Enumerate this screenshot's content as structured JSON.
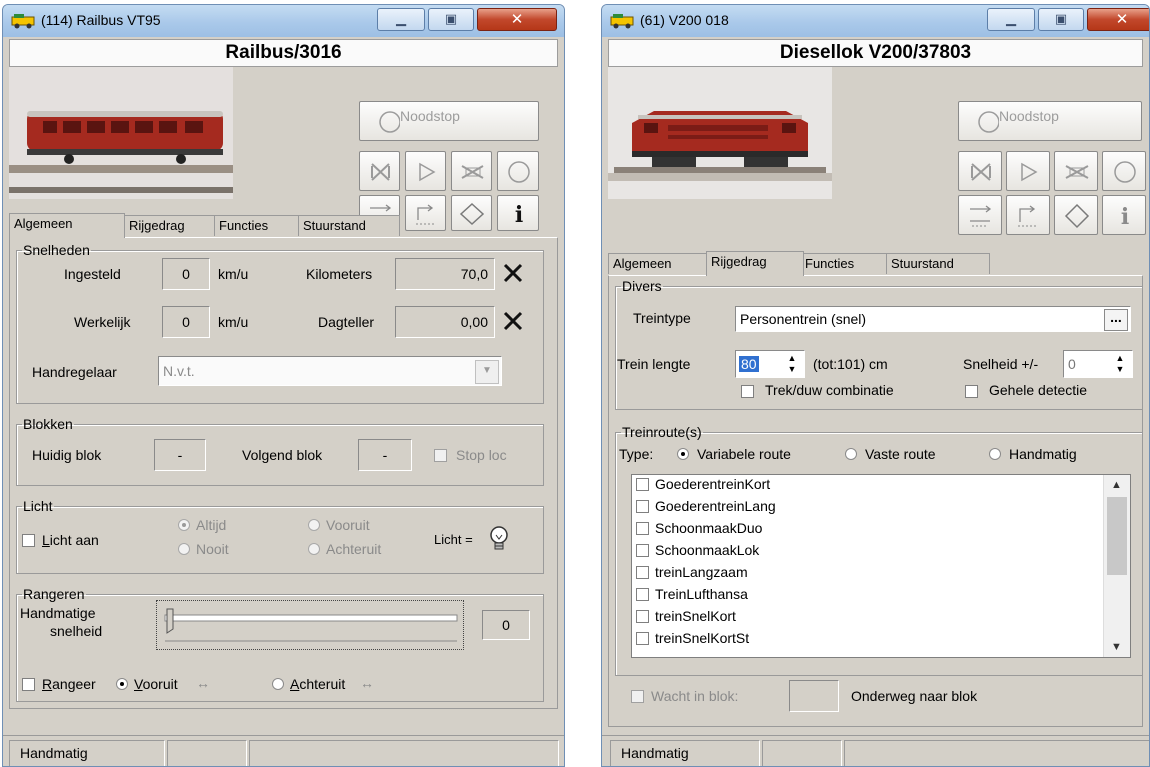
{
  "window_left": {
    "title": "(114) Railbus VT95",
    "header": "Railbus/3016",
    "noodstop_label": "Noodstop",
    "tabs": [
      "Algemeen",
      "Rijgedrag",
      "Functies",
      "Stuurstand"
    ],
    "active_tab": "Algemeen",
    "snelheden": {
      "legend": "Snelheden",
      "ingesteld_label": "Ingesteld",
      "ingesteld_value": "0",
      "unit": "km/u",
      "werkelijk_label": "Werkelijk",
      "werkelijk_value": "0",
      "kilometers_label": "Kilometers",
      "kilometers_value": "70,0",
      "dagteller_label": "Dagteller",
      "dagteller_value": "0,00",
      "handregelaar_label": "Handregelaar",
      "handregelaar_value": "N.v.t."
    },
    "blokken": {
      "legend": "Blokken",
      "huidig_label": "Huidig blok",
      "huidig_value": "-",
      "volgend_label": "Volgend blok",
      "volgend_value": "-",
      "stoploc_label": "Stop loc"
    },
    "licht": {
      "legend": "Licht",
      "licht_aan_label": "Licht aan",
      "altijd": "Altijd",
      "nooit": "Nooit",
      "vooruit": "Vooruit",
      "achteruit": "Achteruit",
      "licht_eq": "Licht ="
    },
    "rangeren": {
      "legend": "Rangeren",
      "handmatige_label": "Handmatige",
      "snelheid_label": "snelheid",
      "slider_value": "0",
      "rangeer_label": "Rangeer",
      "vooruit_label": "Vooruit",
      "achteruit_label": "Achteruit",
      "arrows": "↔"
    },
    "status": [
      "Handmatig",
      "",
      ""
    ]
  },
  "window_right": {
    "title": "(61) V200 018",
    "header": "Diesellok V200/37803",
    "noodstop_label": "Noodstop",
    "tabs": [
      "Algemeen",
      "Rijgedrag",
      "Functies",
      "Stuurstand"
    ],
    "active_tab": "Rijgedrag",
    "divers": {
      "legend": "Divers",
      "treintype_label": "Treintype",
      "treintype_value": "Personentrein (snel)",
      "ellipsis": "...",
      "treinlengte_label": "Trein lengte",
      "treinlengte_value": "80",
      "tot_label": "(tot:101) cm",
      "snelheid_label": "Snelheid +/-",
      "snelheid_value": "0",
      "trekduw_label": "Trek/duw combinatie",
      "gehele_label": "Gehele  detectie"
    },
    "treinroutes": {
      "legend": "Treinroute(s)",
      "type_label": "Type:",
      "variabele": "Variabele route",
      "vaste": "Vaste route",
      "handmatig": "Handmatig",
      "items": [
        "GoederentreinKort",
        "GoederentreinLang",
        "SchoonmaakDuo",
        "SchoonmaakLok",
        "treinLangzaam",
        "TreinLufthansa",
        "treinSnelKort",
        "treinSnelKortSt"
      ]
    },
    "wacht_label": "Wacht in blok:",
    "onderweg_label": "Onderweg naar blok",
    "status": [
      "Handmatig",
      "",
      ""
    ]
  },
  "colors": {
    "loco_red": "#a52a1f",
    "loco_dark_red": "#7b1c16",
    "title_bar": "#aac9ea",
    "close_button": "#c2482c"
  },
  "icons": [
    "app-icon",
    "minimize-icon",
    "maximize-icon",
    "close-icon",
    "noodstop-icon",
    "stop-icon",
    "play-icon",
    "no-loco-icon",
    "circle-icon",
    "reverse-icon",
    "shunt-icon",
    "diamond-icon",
    "info-icon",
    "clear-icon",
    "bulb-icon"
  ]
}
